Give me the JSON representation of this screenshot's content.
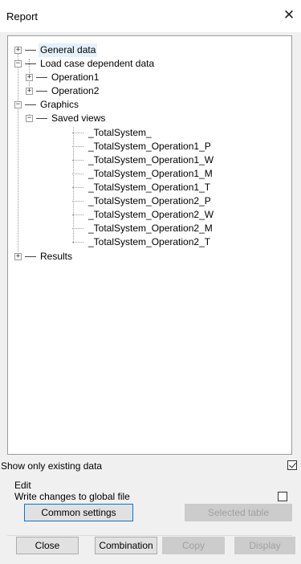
{
  "window": {
    "title": "Report",
    "close_glyph": "✕"
  },
  "tree": {
    "general_data": "General data",
    "load_case": "Load case dependent data",
    "operation1": "Operation1",
    "operation2": "Operation2",
    "graphics": "Graphics",
    "saved_views": "Saved views",
    "views": [
      "_TotalSystem_",
      "_TotalSystem_Operation1_P",
      "_TotalSystem_Operation1_W",
      "_TotalSystem_Operation1_M",
      "_TotalSystem_Operation1_T",
      "_TotalSystem_Operation2_P",
      "_TotalSystem_Operation2_W",
      "_TotalSystem_Operation2_M",
      "_TotalSystem_Operation2_T"
    ],
    "results": "Results",
    "collapsed_glyph": "+",
    "expanded_glyph": "−"
  },
  "options": {
    "show_existing": "Show only existing data",
    "show_existing_checked": true,
    "edit_group": "Edit",
    "write_global": "Write changes to global file",
    "write_global_checked": false
  },
  "buttons": {
    "common_settings": "Common settings",
    "selected_table": "Selected table",
    "close": "Close",
    "combination": "Combination",
    "copy": "Copy",
    "display": "Display"
  }
}
